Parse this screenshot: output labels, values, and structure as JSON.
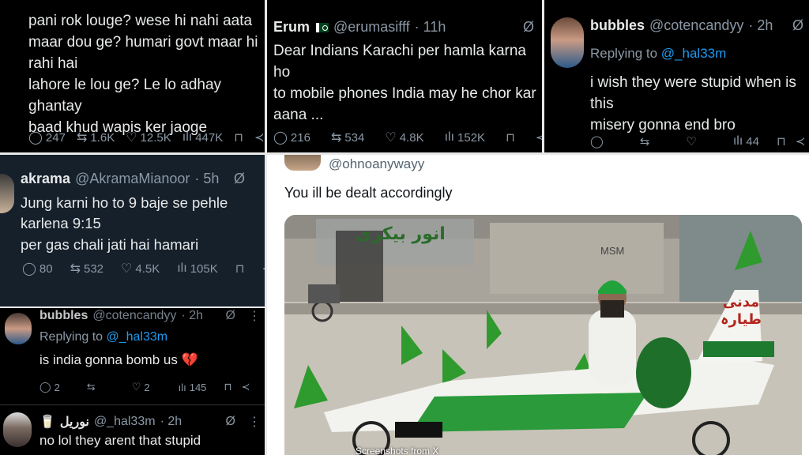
{
  "tweet1": {
    "lines": [
      "pani rok louge? wese hi nahi aata",
      "maar dou ge? humari govt maar hi rahi hai",
      "lahore le lou ge? Le lo adhay ghantay",
      "baad khud wapis ker jaoge"
    ],
    "replies": "247",
    "retweets": "1.6K",
    "likes": "12.5K",
    "views": "447K"
  },
  "tweet2": {
    "name": "Erum",
    "handle": "@erumasifff",
    "time": "· 11h",
    "lines": [
      "Dear Indians Karachi per hamla karna ho",
      "to mobile phones India may he chor kar",
      "aana ..."
    ],
    "replies": "216",
    "retweets": "534",
    "likes": "4.8K",
    "views": "152K"
  },
  "tweet3": {
    "name": "bubbles",
    "handle": "@cotencandyy",
    "time": "· 2h",
    "replying_label": "Replying to",
    "replying_handle": "@_hal33m",
    "lines": [
      "i wish they were stupid when is this",
      "misery gonna end bro"
    ],
    "views": "44"
  },
  "tweet4": {
    "name": "akrama",
    "handle": "@AkramaMianoor",
    "time": "· 5h",
    "lines": [
      "Jung karni ho to 9 baje se pehle karlena 9:15",
      "per gas chali jati hai hamari"
    ],
    "replies": "80",
    "retweets": "532",
    "likes": "4.5K",
    "views": "105K"
  },
  "tweet5": {
    "name": "bubbles",
    "handle": "@cotencandyy",
    "time": "· 2h",
    "replying_label": "Replying to",
    "replying_handle": "@_hal33m",
    "text": "is india gonna bomb us 💔",
    "replies": "2",
    "likes": "2",
    "views": "145"
  },
  "tweet6": {
    "name": "نوریل",
    "handle": "@_hal33m",
    "time": "· 2h",
    "text": "no lol they arent that stupid"
  },
  "tweet7": {
    "handle": "@ohnoanywayy",
    "text": "You ill be dealt accordingly",
    "sign_line1": "مدنی",
    "sign_line2": "طیارہ",
    "wall_text": "انور بیکری",
    "wall_text2": "MSM"
  },
  "caption": "Screenshots from X",
  "colors": {
    "x_black": "#000000",
    "x_dim": "#15202b",
    "x_blue": "#1d9bf0",
    "x_grey": "#8b98a5",
    "flag_green": "#1e8a2a"
  }
}
